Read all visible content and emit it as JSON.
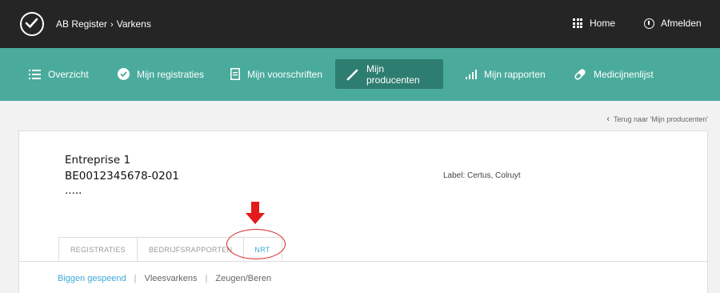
{
  "topbar": {
    "breadcrumb": [
      "AB Register",
      "Varkens"
    ],
    "breadcrumb_sep": "›",
    "home_label": "Home",
    "logout_label": "Afmelden"
  },
  "nav": {
    "items": [
      {
        "label": "Overzicht",
        "icon": "list-icon"
      },
      {
        "label": "Mijn registraties",
        "icon": "check-circle-icon"
      },
      {
        "label": "Mijn voorschriften",
        "icon": "document-icon"
      },
      {
        "label": "Mijn producenten",
        "icon": "syringe-icon",
        "active": true
      },
      {
        "label": "Mijn rapporten",
        "icon": "bar-chart-icon"
      },
      {
        "label": "Medicijnenlijst",
        "icon": "pill-icon"
      }
    ]
  },
  "back_link": "Terug naar 'Mijn producenten'",
  "enterprise": {
    "name": "Entreprise 1",
    "number": "BE0012345678-0201",
    "more": "....."
  },
  "label_text": "Label: Certus, Colruyt",
  "tabs": [
    {
      "label": "REGISTRATIES",
      "active": false
    },
    {
      "label": "BEDRIJFSRAPPORTEN",
      "active": false
    },
    {
      "label": "NRT",
      "active": true
    }
  ],
  "subnav": [
    {
      "label": "Biggen gespeend",
      "active": true
    },
    {
      "label": "Vleesvarkens",
      "active": false
    },
    {
      "label": "Zeugen/Beren",
      "active": false
    }
  ],
  "colors": {
    "topbar": "#252525",
    "nav": "#4aab9c",
    "nav_active": "#2e7d71",
    "accent": "#3fa9d8",
    "annotation": "#d32020"
  }
}
